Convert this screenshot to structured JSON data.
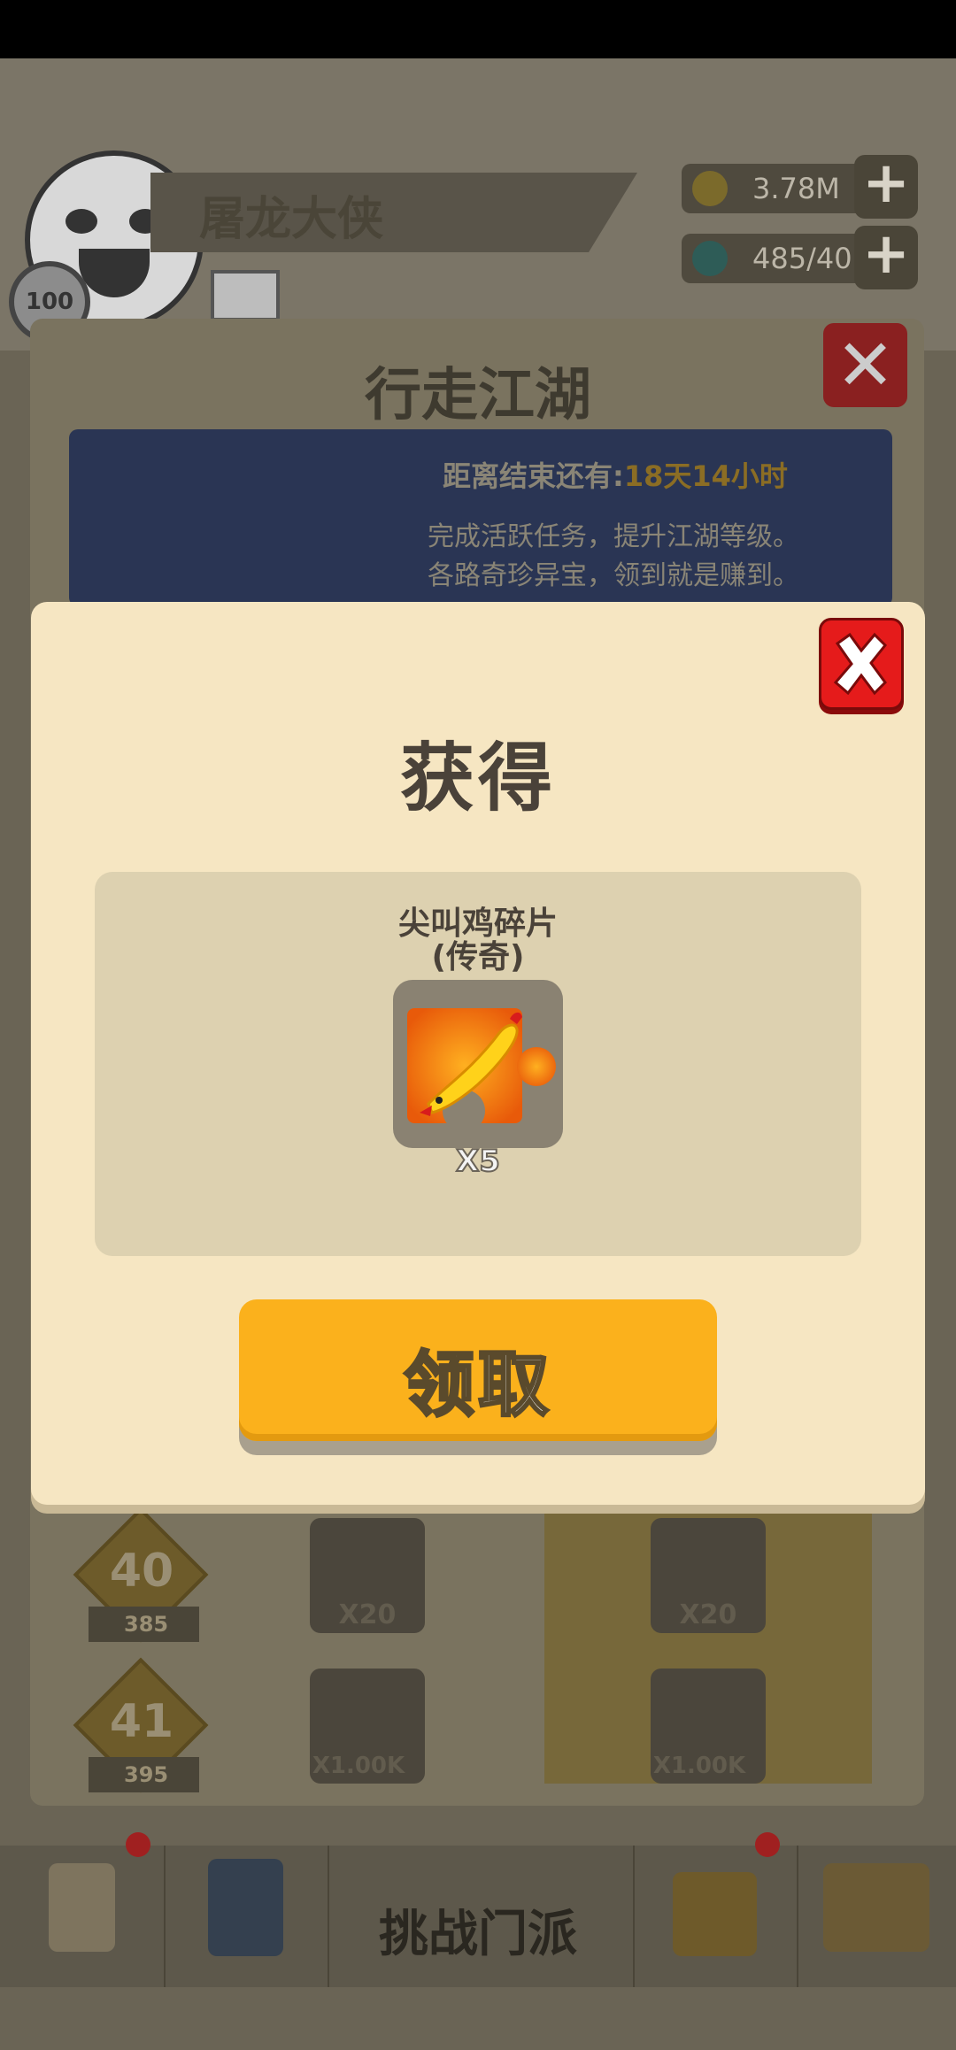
{
  "player": {
    "name": "屠龙大侠",
    "level": "100"
  },
  "resources": {
    "gold": "3.78M",
    "gems": "485/40"
  },
  "event": {
    "title": "行走江湖",
    "time_prefix": "距离结束还有:",
    "time_value": "18天14小时",
    "desc_line1": "完成活跃任务，提升江湖等级。",
    "desc_line2": "各路奇珍异宝，领到就是赚到。"
  },
  "rows": [
    {
      "level": "40",
      "fire": "385",
      "free_reward": "X20",
      "paid_reward": "X20"
    },
    {
      "level": "41",
      "fire": "395",
      "free_reward": "X1.00K",
      "paid_reward": "X1.00K"
    }
  ],
  "bottom_tabs": {
    "center_label": "挑战门派"
  },
  "modal": {
    "title": "获得",
    "item_name_line1": "尖叫鸡碎片",
    "item_name_line2": "(传奇)",
    "item_quantity": "X5",
    "claim_label": "领取"
  },
  "colors": {
    "accent": "#fbb11c",
    "close_red": "#e51b1b",
    "modal_bg": "#f6e6c2"
  },
  "icons": [
    "close-icon",
    "screaming-chicken-icon",
    "gold-coin-icon",
    "gem-icon",
    "plus-icon",
    "mail-icon"
  ]
}
